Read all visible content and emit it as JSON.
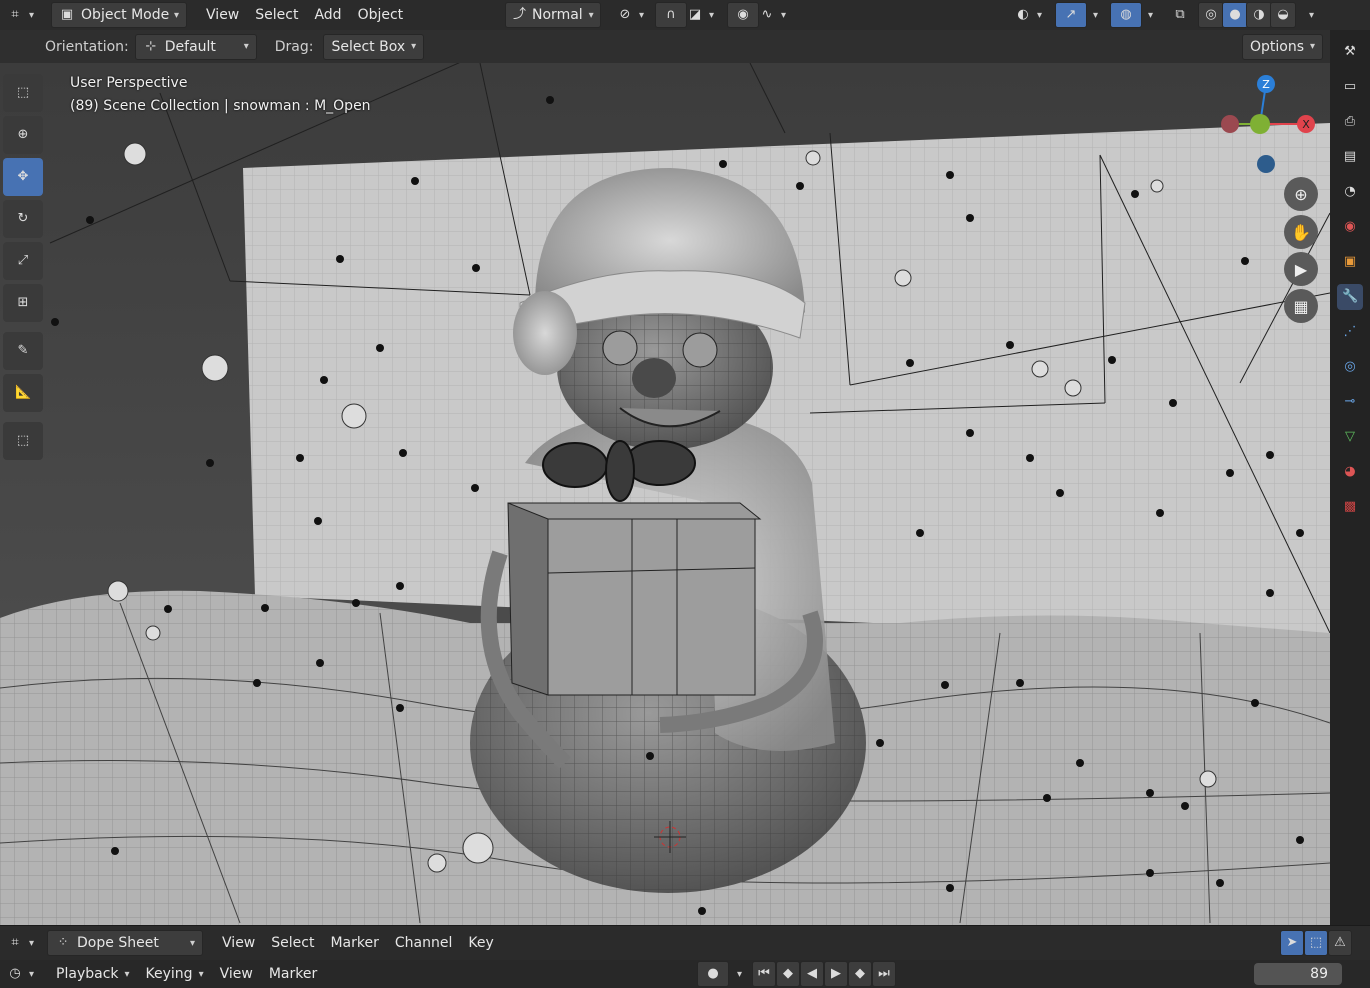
{
  "header": {
    "mode": "Object Mode",
    "menus": [
      "View",
      "Select",
      "Add",
      "Object"
    ],
    "pivot": "Normal"
  },
  "tool_options": {
    "orientation_label": "Orientation:",
    "orientation_value": "Default",
    "drag_label": "Drag:",
    "drag_value": "Select Box",
    "options_label": "Options"
  },
  "viewport": {
    "view_name": "User Perspective",
    "context": "(89) Scene Collection | snowman : M_Open",
    "gizmo_axes": [
      "Z",
      "X"
    ]
  },
  "dope_sheet": {
    "editor": "Dope Sheet",
    "menus": [
      "View",
      "Select",
      "Marker",
      "Channel",
      "Key"
    ]
  },
  "timeline": {
    "menus": [
      "Playback",
      "Keying",
      "View",
      "Marker"
    ],
    "current_frame": "89"
  },
  "icons": {
    "left_tools": [
      "select-box-icon",
      "cursor-icon",
      "move-icon",
      "rotate-icon",
      "scale-icon",
      "transform-icon",
      "annotate-icon",
      "measure-icon",
      "add-cube-icon"
    ],
    "nav": [
      "zoom-icon",
      "hand-icon",
      "camera-icon",
      "grid-icon"
    ],
    "properties": [
      "tool-icon",
      "render-icon",
      "output-icon",
      "view-layer-icon",
      "scene-icon",
      "world-icon",
      "object-icon",
      "modifier-icon",
      "particles-icon",
      "physics-icon",
      "constraints-icon",
      "data-icon",
      "material-icon",
      "texture-icon"
    ]
  },
  "colors": {
    "accent": "#4772b3",
    "axis_x": "#e0434c",
    "axis_y": "#7fb034",
    "axis_z": "#2b7fd8"
  }
}
